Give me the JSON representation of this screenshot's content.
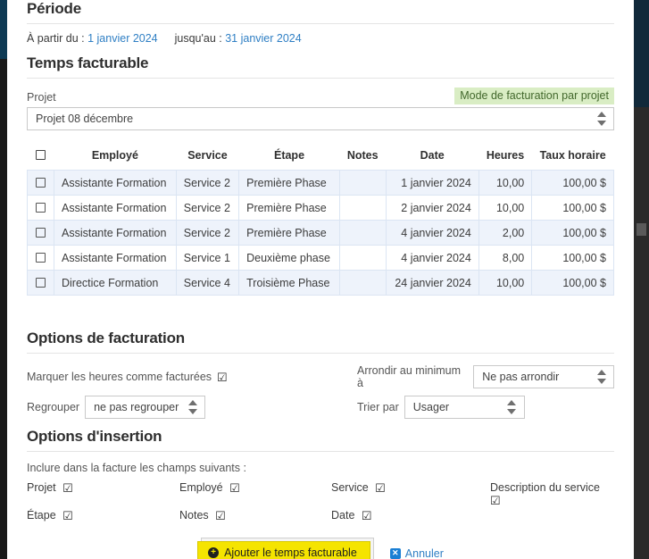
{
  "periode": {
    "heading": "Période",
    "from_label": "À partir du :",
    "from_date": "1 janvier 2024",
    "to_label": "jusqu'au :",
    "to_date": "31 janvier 2024"
  },
  "billable": {
    "heading": "Temps facturable",
    "project_label": "Projet",
    "badge": "Mode de facturation par projet",
    "project_value": "Projet 08 décembre"
  },
  "table": {
    "columns": [
      "",
      "Employé",
      "Service",
      "Étape",
      "Notes",
      "Date",
      "Heures",
      "Taux horaire"
    ],
    "rows": [
      {
        "employe": "Assistante Formation",
        "service": "Service 2",
        "etape": "Première Phase",
        "notes": "",
        "date": "1 janvier 2024",
        "heures": "10,00",
        "taux": "100,00 $"
      },
      {
        "employe": "Assistante Formation",
        "service": "Service 2",
        "etape": "Première Phase",
        "notes": "",
        "date": "2 janvier 2024",
        "heures": "10,00",
        "taux": "100,00 $"
      },
      {
        "employe": "Assistante Formation",
        "service": "Service 2",
        "etape": "Première Phase",
        "notes": "",
        "date": "4 janvier 2024",
        "heures": "2,00",
        "taux": "100,00 $"
      },
      {
        "employe": "Assistante Formation",
        "service": "Service 1",
        "etape": "Deuxième phase",
        "notes": "",
        "date": "4 janvier 2024",
        "heures": "8,00",
        "taux": "100,00 $"
      },
      {
        "employe": "Directice Formation",
        "service": "Service 4",
        "etape": "Troisième Phase",
        "notes": "",
        "date": "24 janvier 2024",
        "heures": "10,00",
        "taux": "100,00 $"
      }
    ]
  },
  "billing_options": {
    "heading": "Options de facturation",
    "mark_billed_label": "Marquer les heures comme facturées",
    "mark_billed_checked": true,
    "round_label": "Arrondir au minimum à",
    "round_value": "Ne pas arrondir",
    "group_label": "Regrouper",
    "group_value": "ne pas regrouper",
    "sort_label": "Trier par",
    "sort_value": "Usager"
  },
  "insert_options": {
    "heading": "Options d'insertion",
    "note": "Inclure dans la facture les champs suivants :",
    "fields": [
      {
        "label": "Projet",
        "checked": true
      },
      {
        "label": "Employé",
        "checked": true
      },
      {
        "label": "Service",
        "checked": true
      },
      {
        "label": "Description du service",
        "checked": true
      },
      {
        "label": "Étape",
        "checked": true
      },
      {
        "label": "Notes",
        "checked": true
      },
      {
        "label": "Date",
        "checked": true
      }
    ]
  },
  "actions": {
    "submit_label": "Ajouter le temps facturable",
    "cancel_label": "Annuler"
  },
  "glyphs": {
    "checked": "☑",
    "plus": "+",
    "close": "✕"
  },
  "colors": {
    "accent_link": "#2f7fc4",
    "badge_bg": "#d9edc4",
    "badge_text": "#42682c",
    "row_stripe": "#eef3fb",
    "primary_btn": "#f5e400"
  }
}
